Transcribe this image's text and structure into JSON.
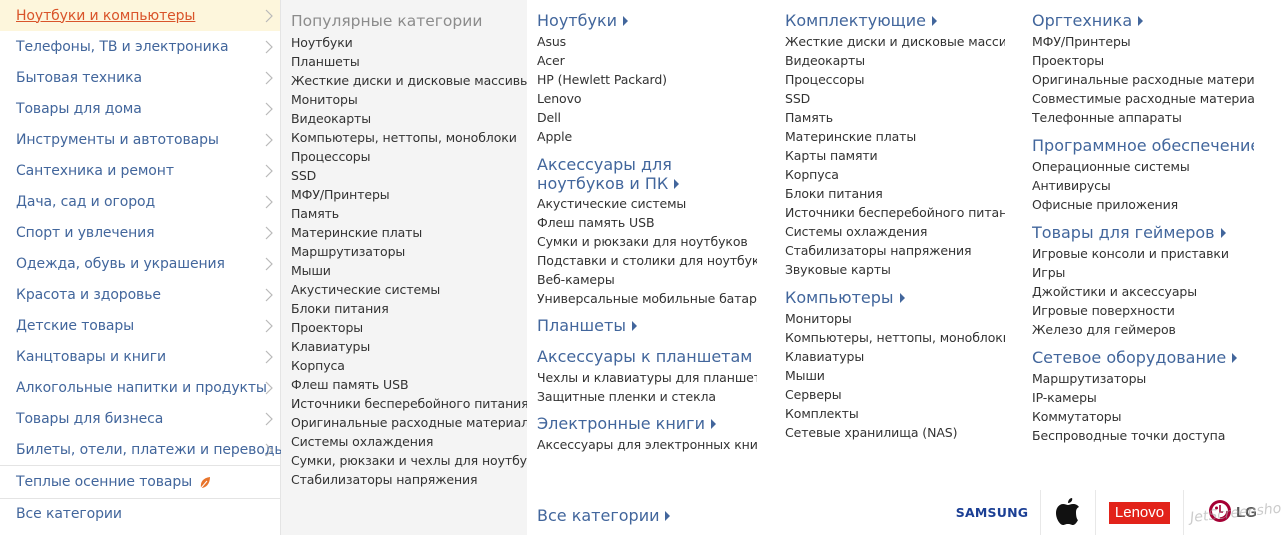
{
  "sidebar": {
    "items": [
      {
        "label": "Ноутбуки и компьютеры"
      },
      {
        "label": "Телефоны, ТВ и электроника"
      },
      {
        "label": "Бытовая техника"
      },
      {
        "label": "Товары для дома"
      },
      {
        "label": "Инструменты и автотовары"
      },
      {
        "label": "Сантехника и ремонт"
      },
      {
        "label": "Дача, сад и огород"
      },
      {
        "label": "Спорт и увлечения"
      },
      {
        "label": "Одежда, обувь и украшения"
      },
      {
        "label": "Красота и здоровье"
      },
      {
        "label": "Детские товары"
      },
      {
        "label": "Канцтовары и книги"
      },
      {
        "label": "Алкогольные напитки и продукты"
      },
      {
        "label": "Товары для бизнеса"
      },
      {
        "label": "Билеты, отели, платежи и переводы"
      }
    ],
    "seasonal_label": "Теплые осенние товары",
    "all_label": "Все категории",
    "active_color": "#d9542a",
    "link_color": "#42669c"
  },
  "popular": {
    "title": "Популярные категории",
    "items": [
      "Ноутбуки",
      "Планшеты",
      "Жесткие диски и дисковые массивы",
      "Мониторы",
      "Видеокарты",
      "Компьютеры, неттопы, моноблоки",
      "Процессоры",
      "SSD",
      "МФУ/Принтеры",
      "Память",
      "Материнские платы",
      "Маршрутизаторы",
      "Мыши",
      "Акустические системы",
      "Блоки питания",
      "Проекторы",
      "Клавиатуры",
      "Корпуса",
      "Флеш память USB",
      "Источники бесперебойного питания",
      "Оригинальные расходные материалы",
      "Системы охлаждения",
      "Сумки, рюкзаки и чехлы для ноутбуков",
      "Стабилизаторы напряжения"
    ]
  },
  "col1": {
    "groups": [
      {
        "title": "Ноутбуки",
        "items": [
          "Asus",
          "Acer",
          "HP (Hewlett Packard)",
          "Lenovo",
          "Dell",
          "Apple"
        ]
      },
      {
        "title": "Аксессуары для ноутбуков и ПК",
        "items": [
          "Акустические системы",
          "Флеш память USB",
          "Сумки и рюкзаки для ноутбуков",
          "Подставки и столики для ноутбуков",
          "Веб-камеры",
          "Универсальные мобильные батареи"
        ]
      },
      {
        "title": "Планшеты",
        "items": []
      },
      {
        "title": "Аксессуары к планшетам",
        "items": [
          "Чехлы и клавиатуры для планшетов",
          "Защитные пленки и стекла"
        ]
      },
      {
        "title": "Электронные книги",
        "items": [
          "Аксессуары для электронных книг"
        ]
      }
    ],
    "all_label": "Все категории"
  },
  "col2": {
    "groups": [
      {
        "title": "Комплектующие",
        "items": [
          "Жесткие диски и дисковые массивы",
          "Видеокарты",
          "Процессоры",
          "SSD",
          "Память",
          "Материнские платы",
          "Карты памяти",
          "Корпуса",
          "Блоки питания",
          "Источники бесперебойного питания",
          "Системы охлаждения",
          "Стабилизаторы напряжения",
          "Звуковые карты"
        ]
      },
      {
        "title": "Компьютеры",
        "items": [
          "Мониторы",
          "Компьютеры, неттопы, моноблоки",
          "Клавиатуры",
          "Мыши",
          "Серверы",
          "Комплекты",
          "Сетевые хранилища (NAS)"
        ]
      }
    ]
  },
  "col3": {
    "groups": [
      {
        "title": "Оргтехника",
        "items": [
          "МФУ/Принтеры",
          "Проекторы",
          "Оригинальные расходные материалы",
          "Совместимые расходные материалы",
          "Телефонные аппараты"
        ]
      },
      {
        "title": "Программное обеспечение",
        "items": [
          "Операционные системы",
          "Антивирусы",
          "Офисные приложения"
        ]
      },
      {
        "title": "Товары для геймеров",
        "items": [
          "Игровые консоли и приставки",
          "Игры",
          "Джойстики и аксессуары",
          "Игровые поверхности",
          "Железо для геймеров"
        ]
      },
      {
        "title": "Сетевое оборудование",
        "items": [
          "Маршрутизаторы",
          "IP-камеры",
          "Коммутаторы",
          "Беспроводные точки доступа"
        ]
      }
    ]
  },
  "brands": {
    "samsung": "SAMSUNG",
    "lenovo": "Lenovo",
    "lg": "LG",
    "apple_icon": "apple-logo-icon",
    "watermark": "JetScreenshot"
  }
}
